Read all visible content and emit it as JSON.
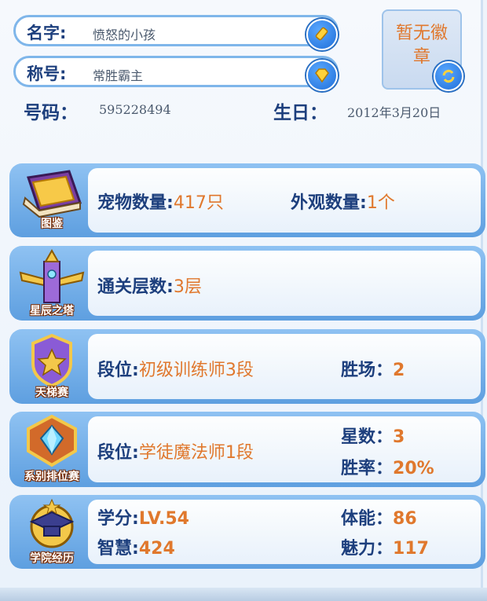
{
  "profile": {
    "name_label": "名字",
    "name_value": "愤怒的小孩",
    "title_label": "称号",
    "title_value": "常胜霸主",
    "number_label": "号码",
    "number_value": "595228494",
    "birthday_label": "生日",
    "birthday_value": "2012年3月20日",
    "badge_text": "暂无徽章"
  },
  "cards": {
    "pokedex": {
      "caption": "图鉴",
      "pet_count_label": "宠物数量",
      "pet_count_value": "417只",
      "appearance_label": "外观数量",
      "appearance_value": "1个"
    },
    "tower": {
      "caption": "星辰之塔",
      "floors_label": "通关层数",
      "floors_value": "3层"
    },
    "ladder": {
      "caption": "天梯赛",
      "rank_label": "段位",
      "rank_value": "初级训练师3段",
      "wins_label": "胜场",
      "wins_value": "2"
    },
    "faction": {
      "caption": "系别排位赛",
      "rank_label": "段位",
      "rank_value": "学徒魔法师1段",
      "stars_label": "星数",
      "stars_value": "3",
      "winrate_label": "胜率",
      "winrate_value": "20%"
    },
    "academy": {
      "caption": "学院经历",
      "credit_label": "学分",
      "credit_value": "LV.54",
      "wisdom_label": "智慧",
      "wisdom_value": "424",
      "stamina_label": "体能",
      "stamina_value": "86",
      "charm_label": "魅力",
      "charm_value": "117"
    }
  },
  "colors": {
    "label": "#1d3f7d",
    "value": "#e0782d",
    "card_border": "#5e9fe0"
  }
}
